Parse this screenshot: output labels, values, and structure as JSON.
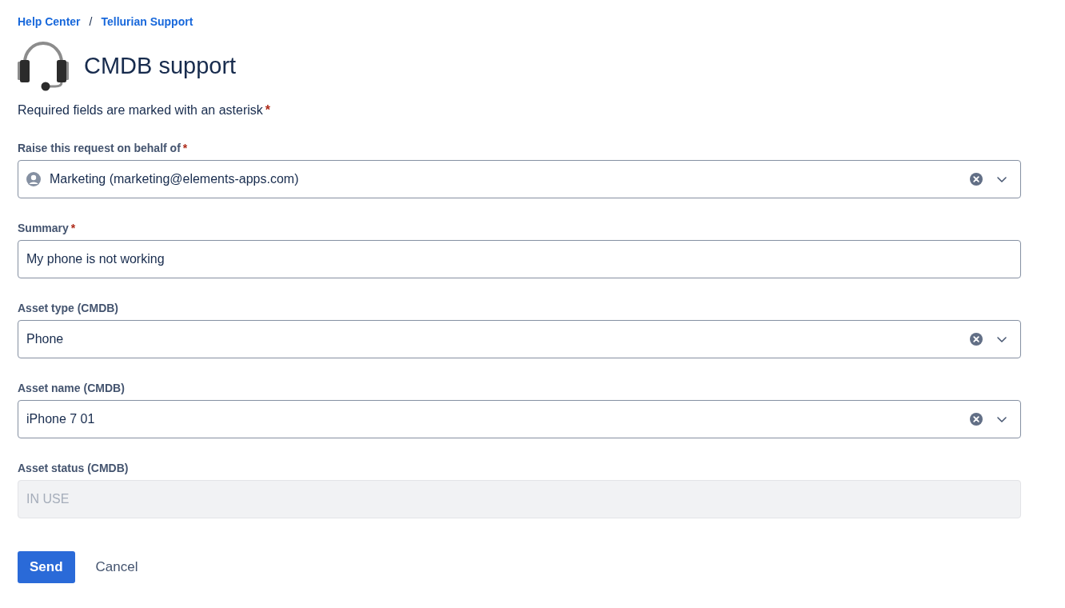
{
  "breadcrumbs": [
    {
      "label": "Help Center"
    },
    {
      "label": "Tellurian Support"
    }
  ],
  "breadcrumb_separator": "/",
  "title": "CMDB support",
  "required_note": {
    "text": "Required fields are marked with an asterisk",
    "marker": "*"
  },
  "fields": [
    {
      "kind": "user-select",
      "label": "Raise this request on behalf of",
      "required_mark": "*",
      "value": "Marketing (marketing@elements-apps.com)",
      "disabled": false
    },
    {
      "kind": "text",
      "label": "Summary",
      "required_mark": "*",
      "value": "My phone is not working",
      "disabled": false
    },
    {
      "kind": "select",
      "label": "Asset type (CMDB)",
      "value": "Phone",
      "disabled": false
    },
    {
      "kind": "select",
      "label": "Asset name (CMDB)",
      "value": "iPhone 7 01",
      "disabled": false
    },
    {
      "kind": "text",
      "label": "Asset status (CMDB)",
      "value": "IN USE",
      "disabled": true
    }
  ],
  "buttons": [
    {
      "label": "Send",
      "kind": "primary"
    },
    {
      "label": "Cancel",
      "kind": "subtle"
    }
  ]
}
